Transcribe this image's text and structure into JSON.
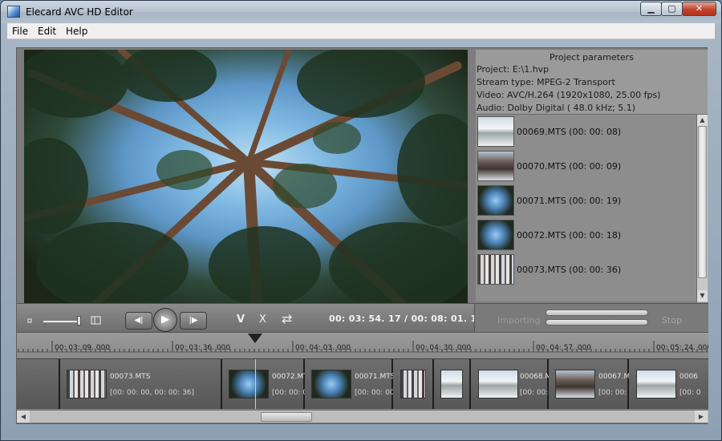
{
  "window": {
    "title": "Elecard AVC HD Editor",
    "min_glyph": "▁",
    "max_glyph": "▢",
    "close_glyph": "✕"
  },
  "menu": {
    "items": [
      "File",
      "Edit",
      "Help"
    ]
  },
  "project": {
    "header": "Project parameters",
    "project": "Project: E:\\1.hvp",
    "stream_type": "Stream type: MPEG-2 Transport",
    "video": "Video: AVC/H.264 (1920x1080, 25.00 fps)",
    "audio": "Audio: Dolby Digital ( 48.0 kHz; 5.1)"
  },
  "clips": [
    {
      "label": "00069.MTS (00: 00: 08)",
      "thumb": "snow"
    },
    {
      "label": "00070.MTS (00: 00: 09)",
      "thumb": "forest"
    },
    {
      "label": "00071.MTS (00: 00: 19)",
      "thumb": "sky"
    },
    {
      "label": "00072.MTS (00: 00: 18)",
      "thumb": "sky"
    },
    {
      "label": "00073.MTS (00: 00: 36)",
      "thumb": "trees"
    }
  ],
  "transport": {
    "timecode": "00: 03: 54. 17 / 00: 08: 01. 13",
    "prev_glyph": "◀|",
    "play_glyph": "▶",
    "next_glyph": "|▶",
    "mark_in_glyph": "V",
    "cut_glyph": "X",
    "swap_glyph": "⇄",
    "importing_label": "Importing",
    "stop_label": "Stop"
  },
  "ruler": {
    "labels": [
      "00: 03: 09. 000",
      "00: 03: 36. 000",
      "00: 04: 03. 000",
      "00: 04: 30. 000",
      "00: 04: 57. 000",
      "00: 05: 24. 000"
    ]
  },
  "timeline": {
    "clips": [
      {
        "name": "",
        "range": "",
        "thumb": ""
      },
      {
        "name": "00073.MTS",
        "range": "[00: 00: 00, 00: 00: 36]",
        "thumb": "trees"
      },
      {
        "name": "00072.MTS",
        "range": "[00: 00: 00,",
        "thumb": "sky"
      },
      {
        "name": "00071.MTS",
        "range": "[00: 00: 00,",
        "thumb": "sky"
      },
      {
        "name": "",
        "range": "",
        "thumb": "trees"
      },
      {
        "name": "",
        "range": "",
        "thumb": "snow"
      },
      {
        "name": "00068.M",
        "range": "[00: 00: 0",
        "thumb": "snow"
      },
      {
        "name": "00067.M",
        "range": "[00: 00: 0",
        "thumb": "forest"
      },
      {
        "name": "0006",
        "range": "[00: 0",
        "thumb": "snow"
      }
    ]
  },
  "scroll": {
    "left_glyph": "◀",
    "right_glyph": "▶",
    "up_glyph": "▲",
    "down_glyph": "▼"
  },
  "icons": [
    "app-icon",
    "volume-low-icon",
    "volume-high-icon",
    "prev-frame-icon",
    "play-icon",
    "next-frame-icon",
    "mark-icon",
    "cut-icon",
    "swap-icon"
  ]
}
